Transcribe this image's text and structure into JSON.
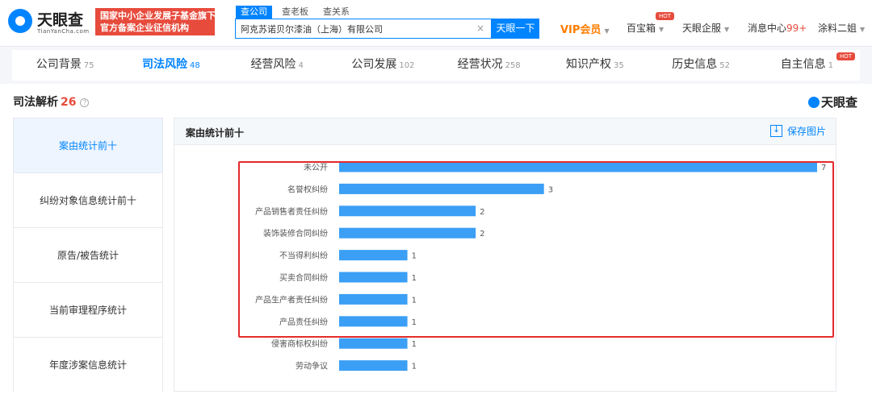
{
  "header": {
    "logo_name": "天眼查",
    "logo_sub": "TianYanCha.com",
    "badge_line1": "国家中小企业发展子基金旗下",
    "badge_line2": "官方备案企业征信机构",
    "search_tabs": [
      "查公司",
      "查老板",
      "查关系"
    ],
    "search_value": "阿克苏诺贝尔漆油（上海）有限公司",
    "search_button": "天眼一下",
    "nav": {
      "vip": "VIP会员",
      "treasure": "百宝箱",
      "hot": "HOT",
      "enterprise": "天眼企服",
      "messages": "消息中心",
      "messages_count": "99+",
      "user": "涂料二姐"
    }
  },
  "tabs": [
    {
      "label": "公司背景",
      "count": "75"
    },
    {
      "label": "司法风险",
      "count": "48"
    },
    {
      "label": "经营风险",
      "count": "4"
    },
    {
      "label": "公司发展",
      "count": "102"
    },
    {
      "label": "经营状况",
      "count": "258"
    },
    {
      "label": "知识产权",
      "count": "35"
    },
    {
      "label": "历史信息",
      "count": "52"
    },
    {
      "label": "自主信息",
      "count": "1",
      "hot": "HOT"
    }
  ],
  "section": {
    "title": "司法解析",
    "count": "26",
    "help": "?",
    "brand": "天眼查"
  },
  "side_menu": [
    "案由统计前十",
    "纠纷对象信息统计前十",
    "原告/被告统计",
    "当前审理程序统计",
    "年度涉案信息统计"
  ],
  "chart_header": {
    "title": "案由统计前十",
    "save_label": "保存图片"
  },
  "chart_data": {
    "type": "bar",
    "orientation": "horizontal",
    "categories": [
      "未公开",
      "名誉权纠纷",
      "产品销售者责任纠纷",
      "装饰装修合同纠纷",
      "不当得利纠纷",
      "买卖合同纠纷",
      "产品生产者责任纠纷",
      "产品责任纠纷",
      "侵害商标权纠纷",
      "劳动争议"
    ],
    "values": [
      7,
      3,
      2,
      2,
      1,
      1,
      1,
      1,
      1,
      1
    ],
    "xlim": [
      0,
      7
    ],
    "bar_color": "#3b9ff5",
    "grid": false
  },
  "colors": {
    "brand": "#0084ff",
    "accent_red": "#e74b3c",
    "vip": "#ff7d00"
  }
}
